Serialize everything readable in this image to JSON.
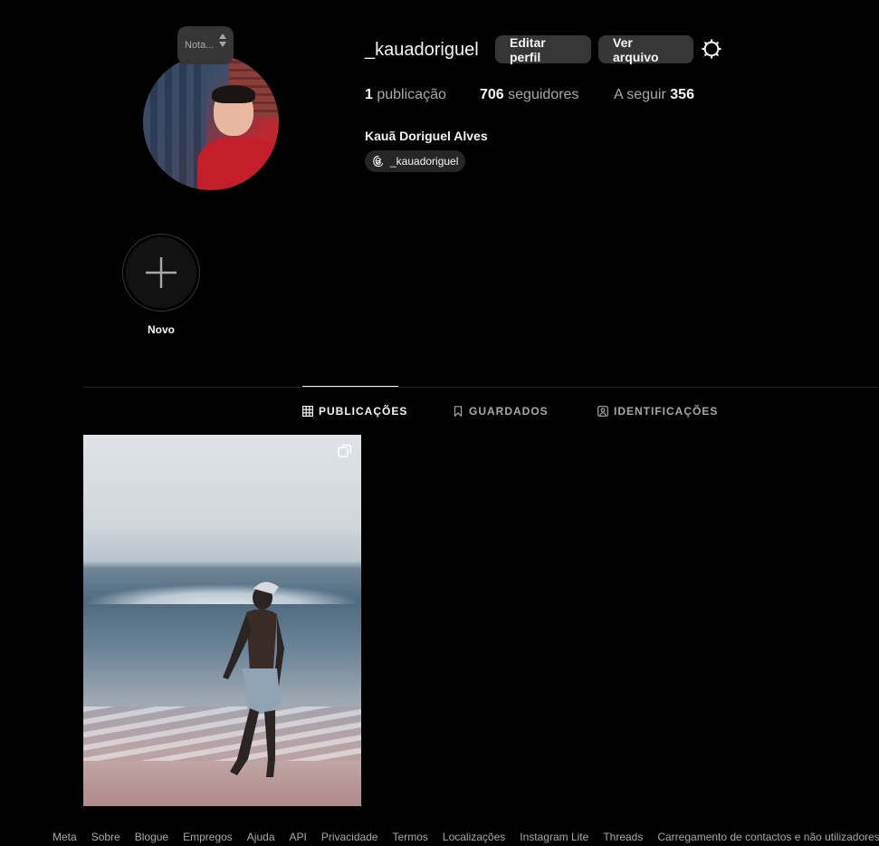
{
  "profile": {
    "username": "_kauadoriguel",
    "full_name": "Kauã Doriguel Alves",
    "threads_handle": "_kauadoriguel",
    "note_placeholder": "Nota..."
  },
  "buttons": {
    "edit_profile": "Editar perfil",
    "view_archive": "Ver arquivo"
  },
  "stats": {
    "posts_count": "1",
    "posts_label": "publicação",
    "followers_count": "706",
    "followers_label": "seguidores",
    "following_label": "A seguir",
    "following_count": "356"
  },
  "highlight": {
    "label": "Novo"
  },
  "tabs": {
    "posts": "PUBLICAÇÕES",
    "saved": "GUARDADOS",
    "tagged": "IDENTIFICAÇÕES"
  },
  "footer": {
    "links": [
      "Meta",
      "Sobre",
      "Blogue",
      "Empregos",
      "Ajuda",
      "API",
      "Privacidade",
      "Termos",
      "Localizações",
      "Instagram Lite",
      "Threads",
      "Carregamento de contactos e não utilizadores"
    ]
  },
  "colors": {
    "background": "#000000",
    "button_bg": "#363636",
    "text_primary": "#f5f5f5",
    "text_secondary": "#a8a8a8"
  },
  "icons": [
    "gear-icon",
    "threads-icon",
    "plus-icon",
    "grid-icon",
    "bookmark-icon",
    "tagged-icon",
    "multiple-posts-icon"
  ]
}
